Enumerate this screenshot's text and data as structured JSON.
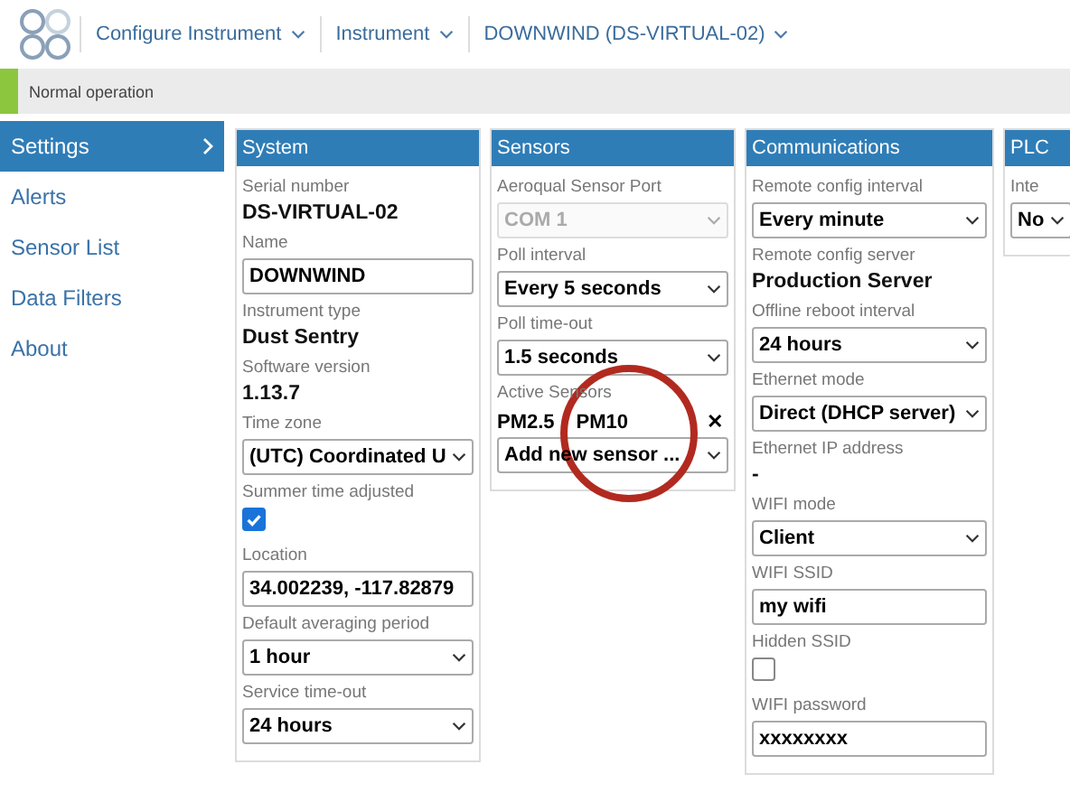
{
  "breadcrumbs": [
    {
      "label": "Configure Instrument"
    },
    {
      "label": "Instrument"
    },
    {
      "label": "DOWNWIND (DS-VIRTUAL-02)"
    }
  ],
  "status_bar": {
    "text": "Normal operation"
  },
  "sidebar": {
    "items": [
      {
        "label": "Settings",
        "selected": true
      },
      {
        "label": "Alerts",
        "selected": false
      },
      {
        "label": "Sensor List",
        "selected": false
      },
      {
        "label": "Data Filters",
        "selected": false
      },
      {
        "label": "About",
        "selected": false
      }
    ]
  },
  "panels": [
    {
      "title": "System",
      "fields": [
        {
          "kind": "readonly",
          "label": "Serial number",
          "value": "DS-VIRTUAL-02"
        },
        {
          "kind": "text",
          "label": "Name",
          "value": "DOWNWIND"
        },
        {
          "kind": "readonly",
          "label": "Instrument type",
          "value": "Dust Sentry"
        },
        {
          "kind": "readonly",
          "label": "Software version",
          "value": "1.13.7"
        },
        {
          "kind": "select",
          "label": "Time zone",
          "value": "(UTC) Coordinated U",
          "disabled": false
        },
        {
          "kind": "checkbox",
          "label": "Summer time adjusted",
          "checked": true
        },
        {
          "kind": "text",
          "label": "Location",
          "value": "34.002239, -117.82879"
        },
        {
          "kind": "select",
          "label": "Default averaging period",
          "value": "1 hour",
          "disabled": false
        },
        {
          "kind": "select",
          "label": "Service time-out",
          "value": "24 hours",
          "disabled": false
        }
      ]
    },
    {
      "title": "Sensors",
      "fields": [
        {
          "kind": "select",
          "label": "Aeroqual Sensor Port",
          "value": "COM 1",
          "disabled": true
        },
        {
          "kind": "select",
          "label": "Poll interval",
          "value": "Every 5 seconds",
          "disabled": false
        },
        {
          "kind": "select",
          "label": "Poll time-out",
          "value": "1.5 seconds",
          "disabled": false
        },
        {
          "kind": "sensors",
          "label": "Active Sensors",
          "sensors": [
            {
              "name": "PM2.5",
              "removable": false
            },
            {
              "name": "PM10",
              "removable": true
            }
          ],
          "remove_icon": "✕",
          "add_placeholder": "Add new sensor ..."
        }
      ]
    },
    {
      "title": "Communications",
      "fields": [
        {
          "kind": "select",
          "label": "Remote config interval",
          "value": "Every minute",
          "disabled": false
        },
        {
          "kind": "readonly",
          "label": "Remote config server",
          "value": "Production Server"
        },
        {
          "kind": "select",
          "label": "Offline reboot interval",
          "value": "24 hours",
          "disabled": false
        },
        {
          "kind": "select",
          "label": "Ethernet mode",
          "value": "Direct (DHCP server)",
          "disabled": false
        },
        {
          "kind": "readonly",
          "label": "Ethernet IP address",
          "value": "-"
        },
        {
          "kind": "select",
          "label": "WIFI mode",
          "value": "Client",
          "disabled": false
        },
        {
          "kind": "text",
          "label": "WIFI SSID",
          "value": "my wifi"
        },
        {
          "kind": "checkbox",
          "label": "Hidden SSID",
          "checked": false
        },
        {
          "kind": "text",
          "label": "WIFI password",
          "value": "xxxxxxxx"
        }
      ]
    },
    {
      "title": "PLC",
      "fields": [
        {
          "kind": "select",
          "label": "Inte",
          "value": "No",
          "disabled": false
        }
      ]
    }
  ]
}
